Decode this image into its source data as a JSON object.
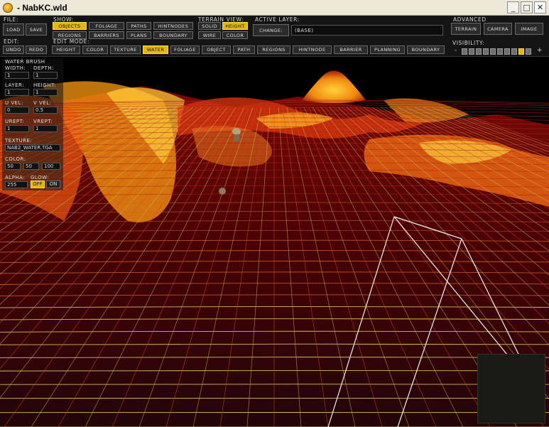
{
  "window": {
    "title": "- NabKC.wld",
    "minimize": "_",
    "maximize": "□",
    "close": "✕"
  },
  "file": {
    "label": "File:",
    "load": "Load",
    "save": "Save"
  },
  "show": {
    "label": "Show:",
    "items": [
      "Objects",
      "Foliage",
      "Paths",
      "HintNodes",
      "Regions",
      "Barriers",
      "Plans",
      "Boundary"
    ]
  },
  "terrain_view": {
    "label": "Terrain View:",
    "items": [
      "Solid",
      "Height",
      "Wire",
      "Color"
    ]
  },
  "active_layer": {
    "label": "Active Layer:",
    "change": "Change:",
    "value": "(Base)"
  },
  "advanced": {
    "label": "Advanced",
    "items": [
      "Terrain",
      "Camera",
      "Image"
    ]
  },
  "visibility": {
    "label": "Visibility:",
    "minus": "-",
    "plus": "+",
    "level": 9,
    "steps": 10
  },
  "edit": {
    "label": "Edit:",
    "undo": "Undo",
    "redo": "Redo"
  },
  "edit_mode": {
    "label": "Edit Mode:",
    "items": [
      "Height",
      "Color",
      "Texture",
      "Water",
      "Foliage",
      "Object",
      "Path",
      "Regions",
      "HintNode",
      "Barrier",
      "Planning",
      "Boundary"
    ]
  },
  "water_brush": {
    "title": "Water Brush",
    "width_label": "Width:",
    "depth_label": "Depth:",
    "width": "1",
    "depth": "1",
    "layer_label": "Layer:",
    "height_label": "Height:",
    "layer": "1",
    "height": "1",
    "uvel_label": "U Vel:",
    "vvel_label": "V Vel:",
    "uvel": "0",
    "vvel": "0.5",
    "urept_label": "URept:",
    "vrept_label": "VRept:",
    "urept": "1",
    "vrept": "1",
    "texture_label": "Texture:",
    "texture": "nab2_water.tga",
    "color_label": "Color:",
    "color_r": "50",
    "color_g": "50",
    "color_b": "100",
    "alpha_label": "Alpha:",
    "glow_label": "Glow:",
    "alpha": "255",
    "glow_off": "Off",
    "glow_on": "On"
  },
  "colors": {
    "accent": "#e2b712",
    "toolbar": "#141414"
  }
}
